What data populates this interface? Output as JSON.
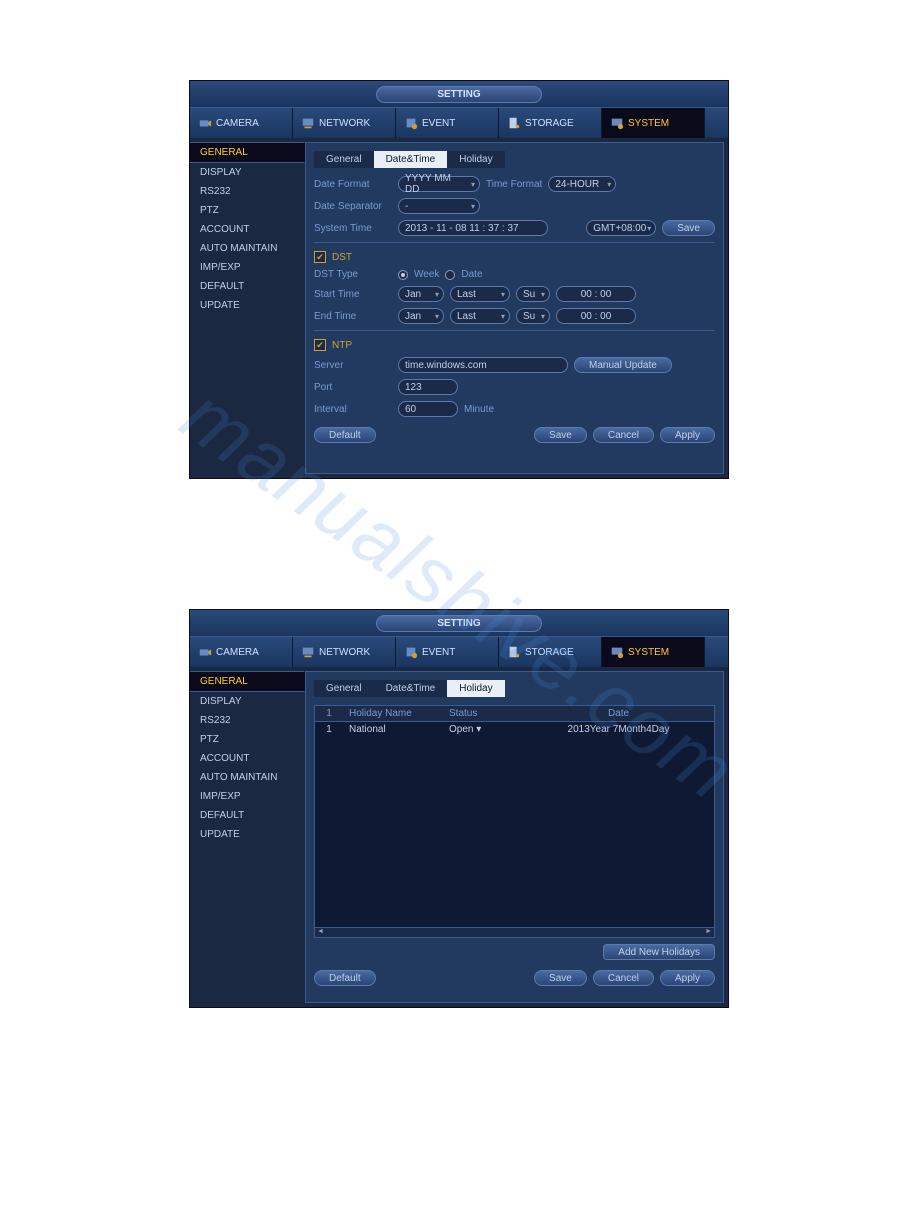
{
  "window_title": "SETTING",
  "top_tabs": [
    "CAMERA",
    "NETWORK",
    "EVENT",
    "STORAGE",
    "SYSTEM"
  ],
  "top_tab_active": "SYSTEM",
  "sidebar": {
    "items": [
      "GENERAL",
      "DISPLAY",
      "RS232",
      "PTZ",
      "ACCOUNT",
      "AUTO MAINTAIN",
      "IMP/EXP",
      "DEFAULT",
      "UPDATE"
    ],
    "active": "GENERAL"
  },
  "panel1": {
    "sub_tabs": [
      "General",
      "Date&Time",
      "Holiday"
    ],
    "active": "Date&Time",
    "date_format_label": "Date Format",
    "date_format_value": "YYYY MM DD",
    "time_format_label": "Time Format",
    "time_format_value": "24-HOUR",
    "date_separator_label": "Date Separator",
    "date_separator_value": "-",
    "system_time_label": "System Time",
    "system_time_value": "2013 - 11 - 08   11 : 37 : 37",
    "timezone_value": "GMT+08:00",
    "save_btn": "Save",
    "dst_label": "DST",
    "dst_checked": true,
    "dst_type_label": "DST Type",
    "dst_week": "Week",
    "dst_date": "Date",
    "dst_type_selected": "Week",
    "start_time_label": "Start Time",
    "end_time_label": "End Time",
    "month_value": "Jan",
    "week_value": "Last",
    "day_value": "Su",
    "hhmm_value": "00  :  00",
    "ntp_label": "NTP",
    "ntp_checked": true,
    "server_label": "Server",
    "server_value": "time.windows.com",
    "manual_update_btn": "Manual Update",
    "port_label": "Port",
    "port_value": "123",
    "interval_label": "Interval",
    "interval_value": "60",
    "interval_unit": "Minute",
    "default_btn": "Default",
    "cancel_btn": "Cancel",
    "apply_btn": "Apply"
  },
  "panel2": {
    "sub_tabs": [
      "General",
      "Date&Time",
      "Holiday"
    ],
    "active": "Holiday",
    "columns": {
      "num": "1",
      "name": "Holiday Name",
      "status": "Status",
      "date": "Date"
    },
    "rows": [
      {
        "num": "1",
        "name": "National",
        "status": "Open ▾",
        "date": "2013Year 7Month4Day"
      }
    ],
    "add_btn": "Add New Holidays",
    "default_btn": "Default",
    "save_btn": "Save",
    "cancel_btn": "Cancel",
    "apply_btn": "Apply"
  }
}
